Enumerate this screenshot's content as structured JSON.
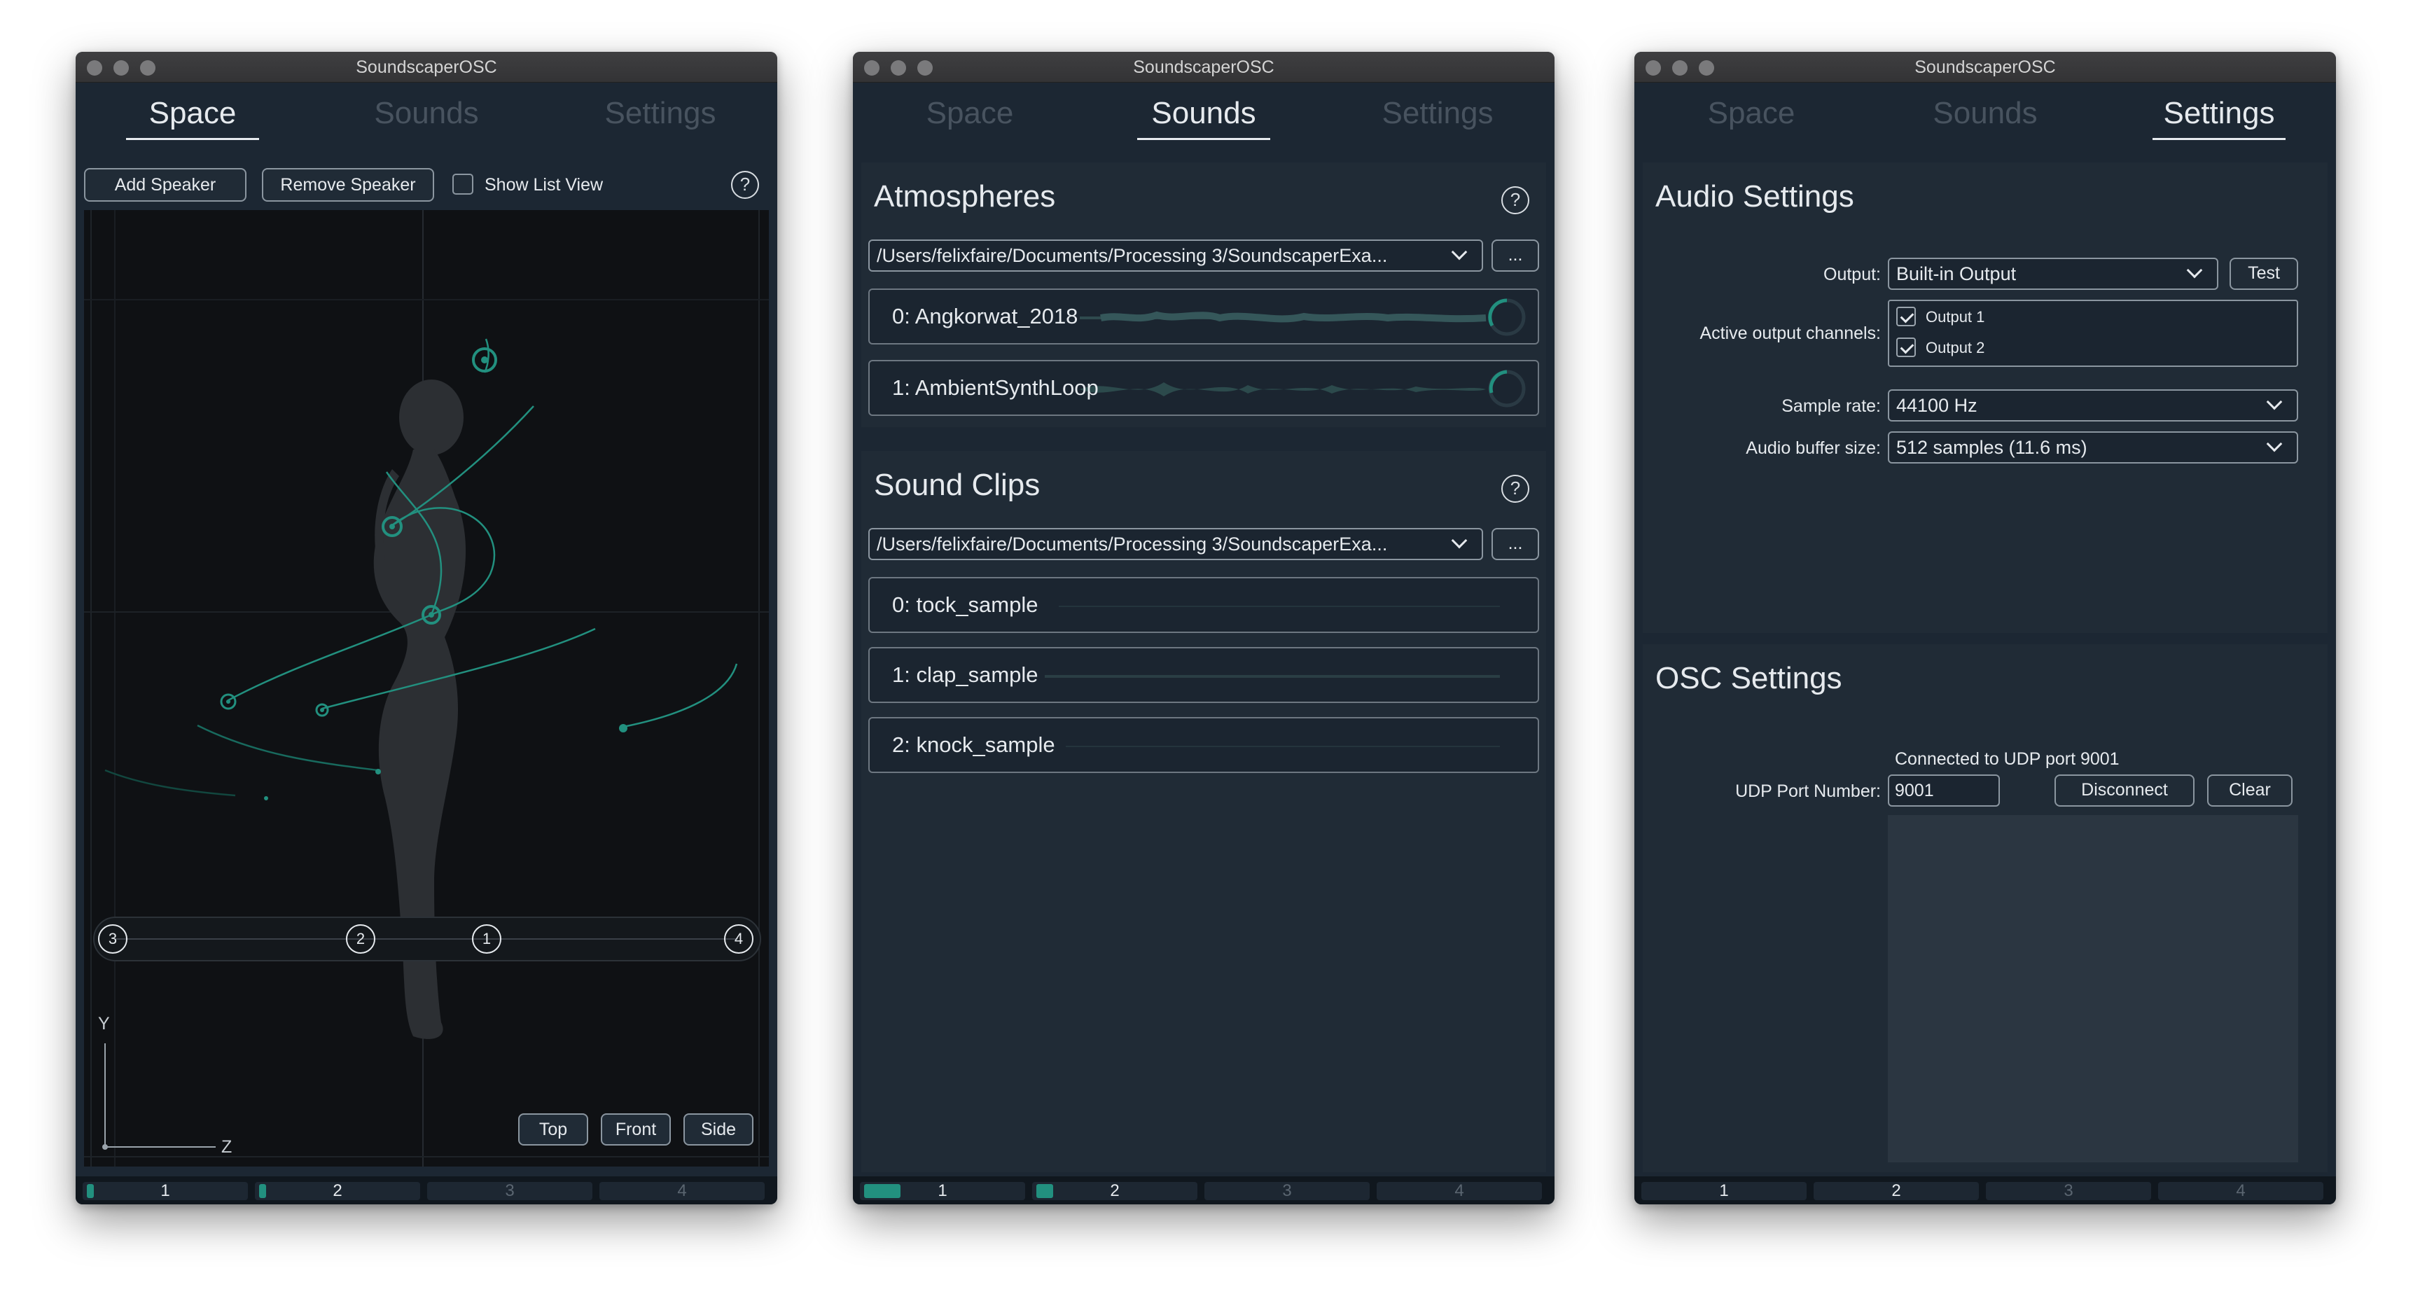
{
  "app_title": "SoundscaperOSC",
  "tabs": [
    "Space",
    "Sounds",
    "Settings"
  ],
  "footer_channels": [
    "1",
    "2",
    "3",
    "4"
  ],
  "space": {
    "add_speaker": "Add Speaker",
    "remove_speaker": "Remove Speaker",
    "show_list_view": "Show List View",
    "help": "?",
    "speakers": [
      "3",
      "2",
      "1",
      "4"
    ],
    "axis_y": "Y",
    "axis_z": "Z",
    "view_top": "Top",
    "view_front": "Front",
    "view_side": "Side"
  },
  "sounds": {
    "atmospheres_title": "Atmospheres",
    "sound_clips_title": "Sound Clips",
    "help": "?",
    "path": "/Users/felixfaire/Documents/Processing 3/SoundscaperExa...",
    "browse": "...",
    "atmospheres": [
      "0: Angkorwat_2018",
      "1: AmbientSynthLoop"
    ],
    "clips": [
      "0: tock_sample",
      "1: clap_sample",
      "2: knock_sample"
    ]
  },
  "settings": {
    "audio_title": "Audio Settings",
    "output_label": "Output:",
    "output_value": "Built-in Output",
    "test": "Test",
    "channels_label": "Active output channels:",
    "channels": [
      "Output 1",
      "Output 2"
    ],
    "sample_rate_label": "Sample rate:",
    "sample_rate_value": "44100 Hz",
    "buffer_label": "Audio buffer size:",
    "buffer_value": "512 samples (11.6 ms)",
    "osc_title": "OSC Settings",
    "status": "Connected to UDP port 9001",
    "udp_label": "UDP Port Number:",
    "udp_value": "9001",
    "disconnect": "Disconnect",
    "clear": "Clear"
  },
  "colors": {
    "accent": "#22907f",
    "background": "#1c2733",
    "panel": "#202b36",
    "text": "#e6eaee"
  }
}
